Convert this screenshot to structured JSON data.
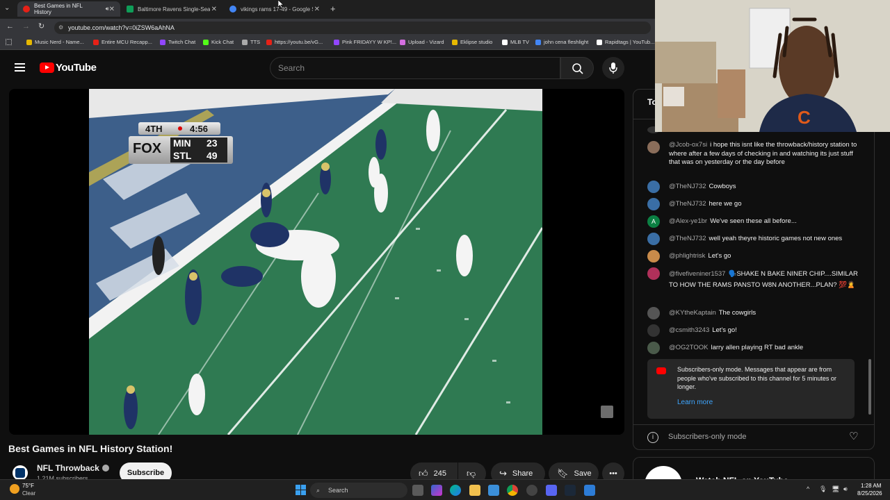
{
  "browser": {
    "tabs": [
      {
        "title": "Best Games in NFL History",
        "color": "#e62117",
        "active": true
      },
      {
        "title": "Baltimore Ravens Single-Seaso",
        "color": "#0f9d58",
        "active": false
      },
      {
        "title": "vikings rams 17-49 - Google Se",
        "color": "#4285f4",
        "active": false
      }
    ],
    "url": "youtube.com/watch?v=0iZSW6aAhNA",
    "bookmarks": [
      {
        "label": "Music Nerd - Name...",
        "color": "#e6b800"
      },
      {
        "label": "Entire MCU Recapp...",
        "color": "#e62117"
      },
      {
        "label": "Twitch Chat",
        "color": "#9146ff"
      },
      {
        "label": "Kick Chat",
        "color": "#53fc18"
      },
      {
        "label": "TTS",
        "color": "#aaaaaa"
      },
      {
        "label": "https://youtu.be/vG...",
        "color": "#e62117"
      },
      {
        "label": "Pink FRIDAYY W KP!...",
        "color": "#9146ff"
      },
      {
        "label": "Upload - Vizard",
        "color": "#d46fe0"
      },
      {
        "label": "Eklipse studio",
        "color": "#e6b800"
      },
      {
        "label": "MLB TV",
        "color": "#ffffff"
      },
      {
        "label": "john cena fleshlight",
        "color": "#4285f4"
      },
      {
        "label": "Rapidtags | YouTub...",
        "color": "#ffffff"
      }
    ]
  },
  "youtube": {
    "logo_text": "YouTube",
    "search_placeholder": "Search"
  },
  "video": {
    "scorebug": {
      "period": "4TH",
      "clock": "4:56",
      "network": "FOX",
      "team1": "MIN",
      "score1": "23",
      "team2": "STL",
      "score2": "49"
    },
    "title": "Best Games in NFL History Station!",
    "channel": "NFL Throwback",
    "subscribers": "1.21M subscribers",
    "subscribe_label": "Subscribe",
    "likes": "245",
    "share_label": "Share",
    "save_label": "Save"
  },
  "chat": {
    "header_partial": "To",
    "messages": [
      {
        "author": "@Jcob-ox7si",
        "text": "i hope this isnt like the throwback/history station to where after a few days of checking in and watching its just stuff that was on yesterday or the day before",
        "avatar_color": "#8a6d5a"
      },
      {
        "author": "@TheNJ732",
        "text": "Cowboys",
        "avatar_color": "#3a6ea5"
      },
      {
        "author": "@TheNJ732",
        "text": "here we go",
        "avatar_color": "#3a6ea5"
      },
      {
        "author": "@Alex-ye1br",
        "text": "We've seen these all before...",
        "avatar_color": "#0b8043",
        "avatar_letter": "A"
      },
      {
        "author": "@TheNJ732",
        "text": "well yeah theyre historic games not new ones",
        "avatar_color": "#3a6ea5"
      },
      {
        "author": "@phlightrisk",
        "text": "Let's go",
        "avatar_color": "#c98b4a"
      },
      {
        "author": "@fivefiveniner1537",
        "text": "🗣️SHAKE N BAKE NINER CHIP....SIMILAR TO HOW THE RAMS PANSTO W8N ANOTHER...PLAN? 💯🙎",
        "avatar_color": "#b0305a"
      },
      {
        "author": "@KYtheKaptain",
        "text": "The cowgirls",
        "avatar_color": "#555555"
      },
      {
        "author": "@csmith3243",
        "text": "Let's go!",
        "avatar_color": "#333333"
      },
      {
        "author": "@OG2TOOK",
        "text": "larry allen playing RT bad ankle",
        "avatar_color": "#4a5a4a"
      }
    ],
    "notice_text": "Subscribers-only mode. Messages that appear are from people who've subscribed to this channel for 5 minutes or longer.",
    "learn_more": "Learn more",
    "footer_label": "Subscribers-only mode"
  },
  "watch_card_partial": "Watch NFL on YouTube",
  "taskbar": {
    "weather_temp": "75°F",
    "weather_desc": "Clear",
    "search_label": "Search",
    "time": "1:28 AM",
    "date": "8/25/2026"
  }
}
